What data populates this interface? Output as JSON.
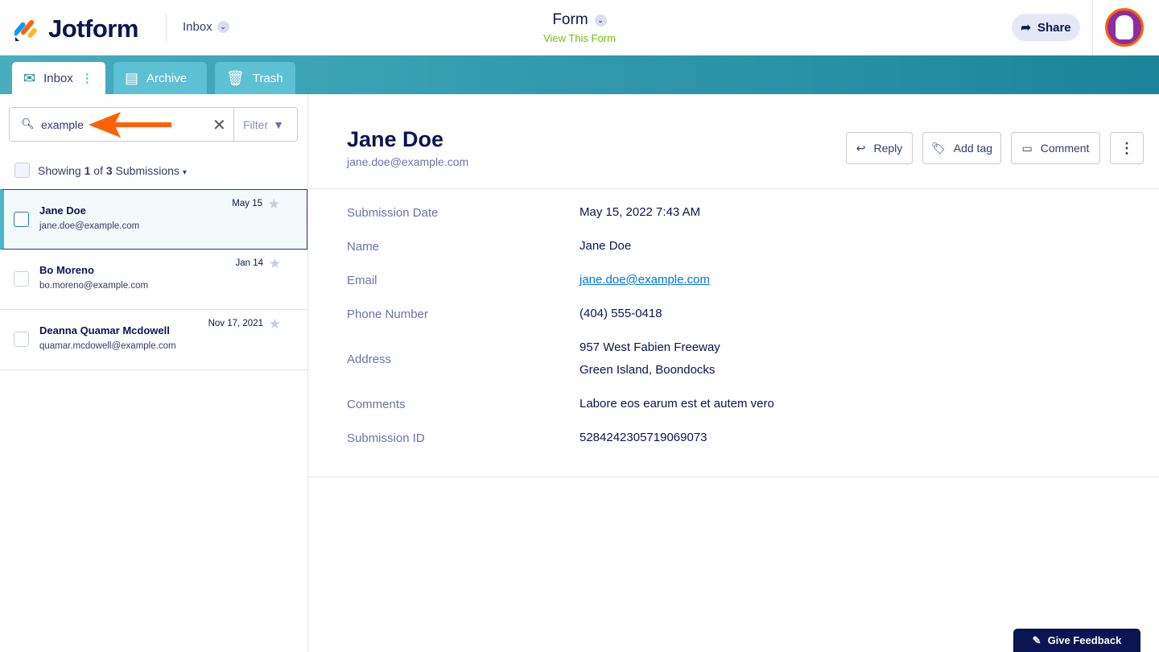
{
  "header": {
    "logo": "Jotform",
    "inbox_dropdown": "Inbox",
    "form_title": "Form",
    "view_form": "View This Form",
    "share": "Share"
  },
  "tabs": [
    {
      "label": "Inbox"
    },
    {
      "label": "Archive"
    },
    {
      "label": "Trash"
    }
  ],
  "search": {
    "value": "example",
    "filter": "Filter"
  },
  "showing": {
    "prefix": "Showing",
    "current": "1",
    "of": "of",
    "total": "3",
    "suffix": "Submissions"
  },
  "submissions": [
    {
      "name": "Jane Doe",
      "email": "jane.doe@example.com",
      "date": "May 15"
    },
    {
      "name": "Bo Moreno",
      "email": "bo.moreno@example.com",
      "date": "Jan 14"
    },
    {
      "name": "Deanna Quamar Mcdowell",
      "email": "quamar.mcdowell@example.com",
      "date": "Nov 17, 2021"
    }
  ],
  "detail": {
    "name": "Jane Doe",
    "email": "jane.doe@example.com",
    "actions": {
      "reply": "Reply",
      "add_tag": "Add tag",
      "comment": "Comment"
    },
    "fields": [
      {
        "label": "Submission Date",
        "value": "May 15, 2022 7:43 AM"
      },
      {
        "label": "Name",
        "value": "Jane Doe"
      },
      {
        "label": "Email",
        "value": "jane.doe@example.com"
      },
      {
        "label": "Phone Number",
        "value": "(404) 555-0418"
      },
      {
        "label": "Address",
        "value": "957 West Fabien Freeway",
        "value2": "Green Island, Boondocks"
      },
      {
        "label": "Comments",
        "value": "Labore eos earum est et autem vero"
      },
      {
        "label": "Submission ID",
        "value": "5284242305719069073"
      }
    ]
  },
  "feedback": "Give Feedback",
  "colors": {
    "accent": "#1b8499",
    "arrow": "#ff6100",
    "navy": "#0a1551"
  }
}
